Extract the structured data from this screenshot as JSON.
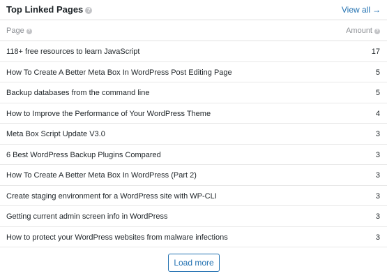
{
  "widget": {
    "title": "Top Linked Pages",
    "help_glyph": "?",
    "view_all_label": "View all",
    "view_all_arrow": "→"
  },
  "columns": {
    "page": "Page",
    "amount": "Amount"
  },
  "rows": [
    {
      "page": "118+ free resources to learn JavaScript",
      "amount": "17"
    },
    {
      "page": "How To Create A Better Meta Box In WordPress Post Editing Page",
      "amount": "5"
    },
    {
      "page": "Backup databases from the command line",
      "amount": "5"
    },
    {
      "page": "How to Improve the Performance of Your WordPress Theme",
      "amount": "4"
    },
    {
      "page": "Meta Box Script Update V3.0",
      "amount": "3"
    },
    {
      "page": "6 Best WordPress Backup Plugins Compared",
      "amount": "3"
    },
    {
      "page": "How To Create A Better Meta Box In WordPress (Part 2)",
      "amount": "3"
    },
    {
      "page": "Create staging environment for a WordPress site with WP-CLI",
      "amount": "3"
    },
    {
      "page": "Getting current admin screen info in WordPress",
      "amount": "3"
    },
    {
      "page": "How to protect your WordPress websites from malware infections",
      "amount": "3"
    }
  ],
  "footer": {
    "load_more_label": "Load more"
  },
  "colors": {
    "accent": "#2271b1",
    "border": "#e0e0e0",
    "muted": "#8c8f94"
  }
}
